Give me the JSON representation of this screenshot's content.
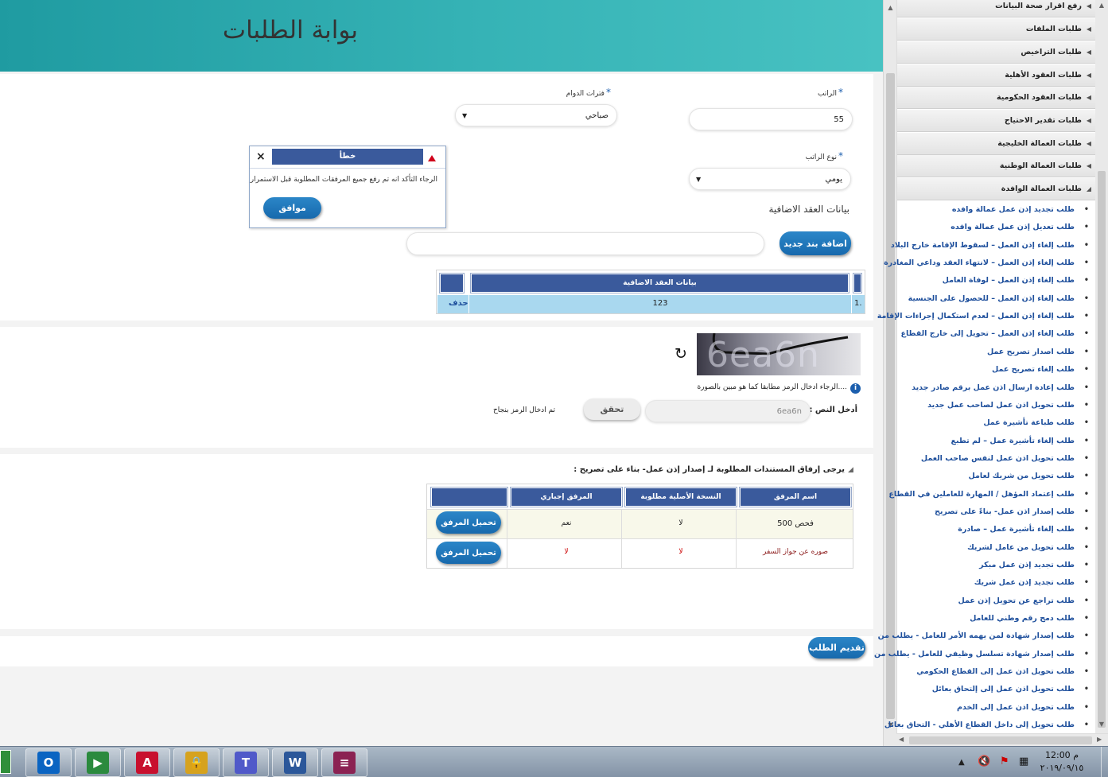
{
  "header": {
    "title": "بوابة الطلبات"
  },
  "form": {
    "salary": {
      "label": "الراتب",
      "value": "55"
    },
    "shift": {
      "label": "فترات الدوام",
      "value": "صباحي"
    },
    "salary_type": {
      "label": "نوع الراتب",
      "value": "يومي"
    }
  },
  "dialog": {
    "title": "خطأ",
    "close": "×",
    "message": "الرجاء التأكد انه تم رفع جميع المرفقات المطلوبة قبل الاستمرار",
    "ok": "موافق"
  },
  "extra": {
    "section_title": "بيانات العقد الاضافية",
    "add_button": "اضافة بند جديد",
    "input_value": "",
    "column": "بيانات العقد الاضافية",
    "rows": [
      {
        "num": "1.",
        "value": "123",
        "action": "حذف"
      }
    ]
  },
  "captcha": {
    "image_text": "6ea6n",
    "hint": "....الرجاء ادخال الرمز مطابقا كما هو مبين بالصورة",
    "label": "أدخل النص :",
    "value": "6ea6n",
    "verify": "تحقق",
    "success": "تم ادخال الرمز بنجاح"
  },
  "attachments": {
    "title": "يرجى إرفاق المستندات المطلوبة لـ إصدار إذن عمل- بناء على تصريح :",
    "columns": [
      "اسم المرفق",
      "النسخة الأصلية مطلوبة",
      "المرفق إجباري",
      ""
    ],
    "rows": [
      {
        "name": "فحص 500",
        "original": "لا",
        "mandatory": "نعم",
        "button": "تحميل المرفق"
      },
      {
        "name": "صوره عن جواز السفر",
        "original": "لا",
        "mandatory": "لا",
        "button": "تحميل المرفق"
      }
    ]
  },
  "submit": "تقديم الطلب",
  "sidebar": {
    "categories": [
      "رفع اقرار صحة البيانات",
      "طلبات الملفات",
      "طلبات التراخيص",
      "طلبات العقود الأهلية",
      "طلبات العقود الحكومية",
      "طلبات تقدير الاحتياج",
      "طلبات العمالة الخليجية",
      "طلبات العمالة الوطنية",
      "طلبات العمالة الوافدة"
    ],
    "items": [
      "طلب تجديد إذن عمل عمالة وافده",
      "طلب تعديل إذن عمل عمالة وافده",
      "طلب إلغاء إذن العمل – لسقوط الإقامة خارج البلاد",
      "طلب إلغاء إذن العمل – لانتهاء العقد وداعي المغادرة",
      "طلب إلغاء إذن العمل – لوفاة العامل",
      "طلب إلغاء إذن العمل – للحصول على الجنسية",
      "طلب إلغاء إذن العمل – لعدم استكمال إجراءات الإقامة",
      "طلب إلغاء إذن العمل – تحويل إلى خارج القطاع",
      "طلب اصدار تصريح عمل",
      "طلب إلغاء تصريح عمل",
      "طلب إعادة ارسال اذن عمل برقم صادر جديد",
      "طلب تحويل اذن عمل لصاحب عمل جديد",
      "طلب طباعة تأشيرة عمل",
      "طلب إلغاء تأشيرة عمل – لم تطبع",
      "طلب تحويل اذن عمل لنفس صاحب العمل",
      "طلب تحويل من شريك لعامل",
      "طلب إعتماد المؤهل / المهارة للعاملين في القطاع",
      "طلب إصدار اذن عمل- بناءً على تصريح",
      "طلب إلغاء تأشيرة عمل – صادرة",
      "طلب تحويل من عامل لشريك",
      "طلب تجديد إذن عمل مبكر",
      "طلب تجديد إذن عمل شريك",
      "طلب تراجع عن تحويل إذن عمل",
      "طلب دمج رقم وطني للعامل",
      "طلب إصدار شهادة لمن يهمه الأمر للعامل - يطلب من",
      "طلب إصدار شهادة تسلسل وظيفي للعامل - يطلب من",
      "طلب تحويل اذن عمل إلى القطاع الحكومي",
      "طلب تحويل اذن عمل إلى إلتحاق بعائل",
      "طلب تحويل اذن عمل إلى الخدم",
      "طلب تحويل إلى داخل القطاع الأهلي - التحاق بعائل"
    ]
  },
  "taskbar": {
    "apps": [
      {
        "icon": "outlook-icon",
        "glyph": "O",
        "color": "#0a64c2"
      },
      {
        "icon": "media-app-icon",
        "glyph": "▶",
        "color": "#2b8a3e"
      },
      {
        "icon": "pdf-icon",
        "glyph": "A",
        "color": "#c8102e"
      },
      {
        "icon": "lock-app-icon",
        "glyph": "🔒",
        "color": "#d6a21e"
      },
      {
        "icon": "teams-icon",
        "glyph": "T",
        "color": "#5059c9"
      },
      {
        "icon": "word-icon",
        "glyph": "W",
        "color": "#2b579a"
      },
      {
        "icon": "winrar-icon",
        "glyph": "≡",
        "color": "#8b2252"
      }
    ],
    "time": "12:00 م",
    "date": "٢٠١٩/٠٩/١٥"
  },
  "colors": {
    "accent": "#1769ad",
    "header": "#36b3b6",
    "table_header": "#3a5a9c",
    "link": "#1e4f9c"
  }
}
